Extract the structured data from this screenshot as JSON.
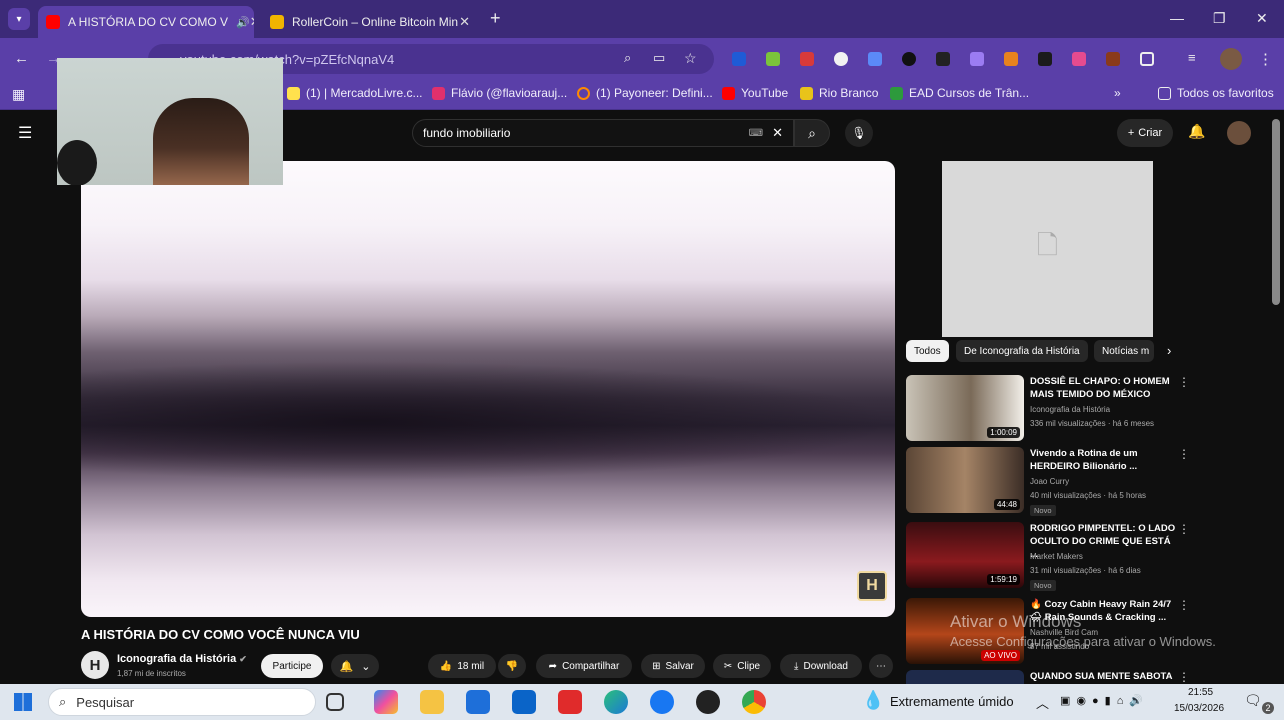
{
  "browser": {
    "tabs": [
      {
        "title": "A HISTÓRIA DO CV COMO V",
        "active": true
      },
      {
        "title": "RollerCoin – Online Bitcoin Min",
        "active": false
      }
    ],
    "url": "youtube.com/watch?v=pZEfcNqnaV4",
    "bookmarks": [
      {
        "label": "(1) | MercadoLivre.c..."
      },
      {
        "label": "Flávio (@flavioarauj..."
      },
      {
        "label": "(1) Payoneer: Defini..."
      },
      {
        "label": "YouTube"
      },
      {
        "label": "Rio Branco"
      },
      {
        "label": "EAD Cursos de Trân..."
      }
    ],
    "all_bookmarks": "Todos os favoritos"
  },
  "youtube": {
    "search_value": "fundo imobiliario",
    "create_label": "Criar",
    "video": {
      "title": "A HISTÓRIA DO CV COMO VOCÊ NUNCA VIU",
      "channel": "Iconografia da História",
      "subscribers": "1,87 mi de inscritos",
      "join_label": "Participe",
      "likes": "18 mil",
      "share_label": "Compartilhar",
      "save_label": "Salvar",
      "clip_label": "Clipe",
      "download_label": "Download"
    },
    "chips": [
      "Todos",
      "De Iconografia da História",
      "Notícias m"
    ],
    "recommendations": [
      {
        "title": "DOSSIÊ EL CHAPO: O HOMEM MAIS TEMIDO DO MÉXICO",
        "channel": "Iconografia da História",
        "meta": "336 mil visualizações · há 6 meses",
        "duration": "1:00:09",
        "badge": ""
      },
      {
        "title": "Vivendo a Rotina de um HERDEIRO Bilionário ...",
        "channel": "Joao Curry",
        "meta": "40 mil visualizações · há 5 horas",
        "duration": "44:48",
        "badge": "Novo"
      },
      {
        "title": "RODRIGO PIMPENTEL: O LADO OCULTO DO CRIME QUE ESTÁ ...",
        "channel": "Market Makers",
        "meta": "31 mil visualizações · há 6 dias",
        "duration": "1:59:19",
        "badge": "Novo"
      },
      {
        "title": "🔥 Cozy Cabin Heavy Rain 24/7 🌧 Rain Sounds & Cracking ...",
        "channel": "Nashville Bird Cam",
        "meta": "87 mil assistindo",
        "duration": "AO VIVO",
        "badge": ""
      },
      {
        "title": "QUANDO SUA MENTE SABOTA",
        "channel": "",
        "meta": "",
        "duration": "",
        "badge": ""
      }
    ]
  },
  "windows_watermark": {
    "line1": "Ativar o Windows",
    "line2": "Acesse Configurações para ativar o Windows."
  },
  "taskbar": {
    "search_placeholder": "Pesquisar",
    "weather": "Extremamente úmido",
    "time": "21:55",
    "date": "15/03/2026",
    "notifications": "2"
  }
}
